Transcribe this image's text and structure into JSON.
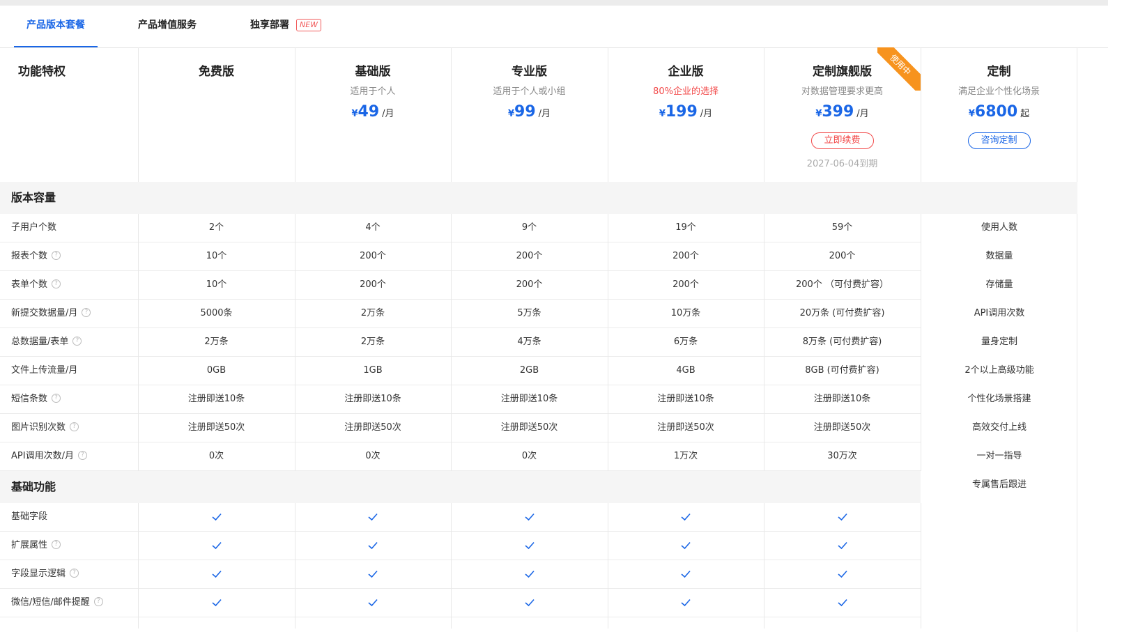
{
  "tabs": [
    {
      "label": "产品版本套餐",
      "active": true
    },
    {
      "label": "产品增值服务",
      "active": false
    },
    {
      "label": "独享部署",
      "active": false,
      "badge": "NEW"
    }
  ],
  "header": {
    "feature_title": "功能特权",
    "plans": [
      {
        "name": "免费版",
        "subtitle": "",
        "currency": "",
        "price": "",
        "unit": ""
      },
      {
        "name": "基础版",
        "subtitle": "适用于个人",
        "currency": "¥",
        "price": "49",
        "unit": "/月"
      },
      {
        "name": "专业版",
        "subtitle": "适用于个人或小组",
        "currency": "¥",
        "price": "99",
        "unit": "/月"
      },
      {
        "name": "企业版",
        "subtitle": "80%企业的选择",
        "currency": "¥",
        "price": "199",
        "unit": "/月",
        "subtitle_color": "#f24a4a"
      },
      {
        "name": "定制旗舰版",
        "subtitle": "对数据管理要求更高",
        "currency": "¥",
        "price": "399",
        "unit": "/月",
        "button": "立即续费",
        "expire": "2027-06-04到期",
        "ribbon": "使用中"
      },
      {
        "name": "定制",
        "subtitle": "满足企业个性化场景",
        "currency": "¥",
        "price": "6800",
        "unit": "起",
        "button": "咨询定制"
      }
    ]
  },
  "sections": {
    "capacity": "版本容量",
    "basic": "基础功能"
  },
  "capacity_rows": [
    {
      "label": "子用户个数",
      "help": false,
      "values": [
        "2个",
        "4个",
        "9个",
        "19个",
        "59个"
      ]
    },
    {
      "label": "报表个数",
      "help": true,
      "values": [
        "10个",
        "200个",
        "200个",
        "200个",
        "200个"
      ]
    },
    {
      "label": "表单个数",
      "help": true,
      "values": [
        "10个",
        "200个",
        "200个",
        "200个",
        "200个 （可付费扩容）"
      ]
    },
    {
      "label": "新提交数据量/月",
      "help": true,
      "values": [
        "5000条",
        "2万条",
        "5万条",
        "10万条",
        "20万条 (可付费扩容)"
      ]
    },
    {
      "label": "总数据量/表单",
      "help": true,
      "values": [
        "2万条",
        "2万条",
        "4万条",
        "6万条",
        "8万条 (可付费扩容)"
      ]
    },
    {
      "label": "文件上传流量/月",
      "help": false,
      "values": [
        "0GB",
        "1GB",
        "2GB",
        "4GB",
        "8GB (可付费扩容)"
      ]
    },
    {
      "label": "短信条数",
      "help": true,
      "values": [
        "注册即送10条",
        "注册即送10条",
        "注册即送10条",
        "注册即送10条",
        "注册即送10条"
      ]
    },
    {
      "label": "图片识别次数",
      "help": true,
      "values": [
        "注册即送50次",
        "注册即送50次",
        "注册即送50次",
        "注册即送50次",
        "注册即送50次"
      ]
    },
    {
      "label": "API调用次数/月",
      "help": true,
      "values": [
        "0次",
        "0次",
        "0次",
        "1万次",
        "30万次"
      ]
    }
  ],
  "custom_features": [
    "使用人数",
    "数据量",
    "存储量",
    "API调用次数",
    "量身定制",
    "2个以上高级功能",
    "个性化场景搭建",
    "高效交付上线",
    "一对一指导",
    "专属售后跟进"
  ],
  "basic_rows": [
    {
      "label": "基础字段",
      "help": false
    },
    {
      "label": "扩展属性",
      "help": true
    },
    {
      "label": "字段显示逻辑",
      "help": true
    },
    {
      "label": "微信/短信/邮件提醒",
      "help": true
    }
  ],
  "help_glyph": "?",
  "colors": {
    "accent": "#1a66e6",
    "danger": "#f24a4a",
    "ribbon": "#f7931e"
  }
}
